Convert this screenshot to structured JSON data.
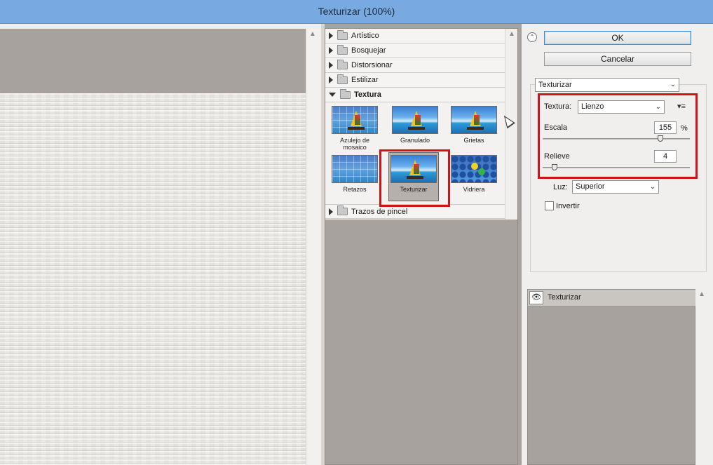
{
  "window": {
    "title": "Texturizar (100%)"
  },
  "gallery": {
    "categories": [
      {
        "label": "Artístico"
      },
      {
        "label": "Bosquejar"
      },
      {
        "label": "Distorsionar"
      },
      {
        "label": "Estilizar"
      },
      {
        "label": "Textura"
      }
    ],
    "textura_filters": [
      {
        "label": "Azulejo de mosaico"
      },
      {
        "label": "Granulado"
      },
      {
        "label": "Grietas"
      },
      {
        "label": "Retazos"
      },
      {
        "label": "Texturizar"
      },
      {
        "label": "Vidriera"
      }
    ],
    "selected_filter": "Texturizar",
    "last_category": "Trazos de pincel"
  },
  "buttons": {
    "ok": "OK",
    "cancel": "Cancelar"
  },
  "settings": {
    "filter_select": "Texturizar",
    "textura_label": "Textura:",
    "textura_value": "Lienzo",
    "escala_label": "Escala",
    "escala_value": "155",
    "escala_unit": "%",
    "escala_level_pct": 80,
    "relieve_label": "Relieve",
    "relieve_value": "4",
    "relieve_level_pct": 8,
    "luz_label": "Luz:",
    "luz_value": "Superior",
    "invertir_label": "Invertir",
    "invertir_checked": false
  },
  "layers": {
    "items": [
      {
        "label": "Texturizar",
        "visible": true
      }
    ]
  },
  "icons": {
    "collapse": "double-chevron-up-icon",
    "eye": "eye-icon",
    "folder": "folder-icon",
    "menu": "panel-menu-icon"
  },
  "colors": {
    "highlight": "#d0121a",
    "titlebar": "#78aae1"
  }
}
